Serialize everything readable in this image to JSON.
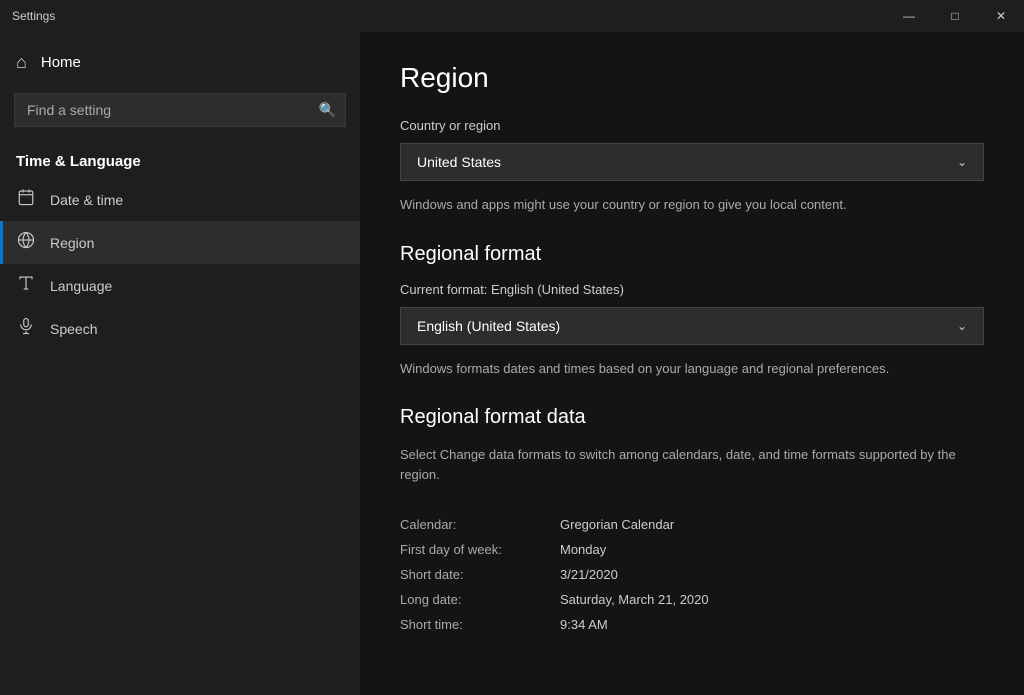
{
  "titleBar": {
    "title": "Settings",
    "minimize": "—",
    "maximize": "□",
    "close": "✕"
  },
  "sidebar": {
    "homeLabel": "Home",
    "searchPlaceholder": "Find a setting",
    "sectionTitle": "Time & Language",
    "navItems": [
      {
        "id": "date-time",
        "label": "Date & time",
        "icon": "📅"
      },
      {
        "id": "region",
        "label": "Region",
        "icon": "🌐",
        "active": true
      },
      {
        "id": "language",
        "label": "Language",
        "icon": "🔤"
      },
      {
        "id": "speech",
        "label": "Speech",
        "icon": "🎤"
      }
    ]
  },
  "main": {
    "pageTitle": "Region",
    "countrySection": {
      "label": "Country or region",
      "dropdownValue": "United States",
      "description": "Windows and apps might use your country or region to give you local content."
    },
    "regionalFormat": {
      "heading": "Regional format",
      "formatLabel": "Current format: English (United States)",
      "dropdownValue": "English (United States)",
      "description": "Windows formats dates and times based on your language and regional preferences."
    },
    "regionalFormatData": {
      "heading": "Regional format data",
      "description": "Select Change data formats to switch among calendars, date, and time formats supported by the region.",
      "rows": [
        {
          "label": "Calendar:",
          "value": "Gregorian Calendar"
        },
        {
          "label": "First day of week:",
          "value": "Monday"
        },
        {
          "label": "Short date:",
          "value": "3/21/2020"
        },
        {
          "label": "Long date:",
          "value": "Saturday, March 21, 2020"
        },
        {
          "label": "Short time:",
          "value": "9:34 AM"
        }
      ]
    }
  }
}
